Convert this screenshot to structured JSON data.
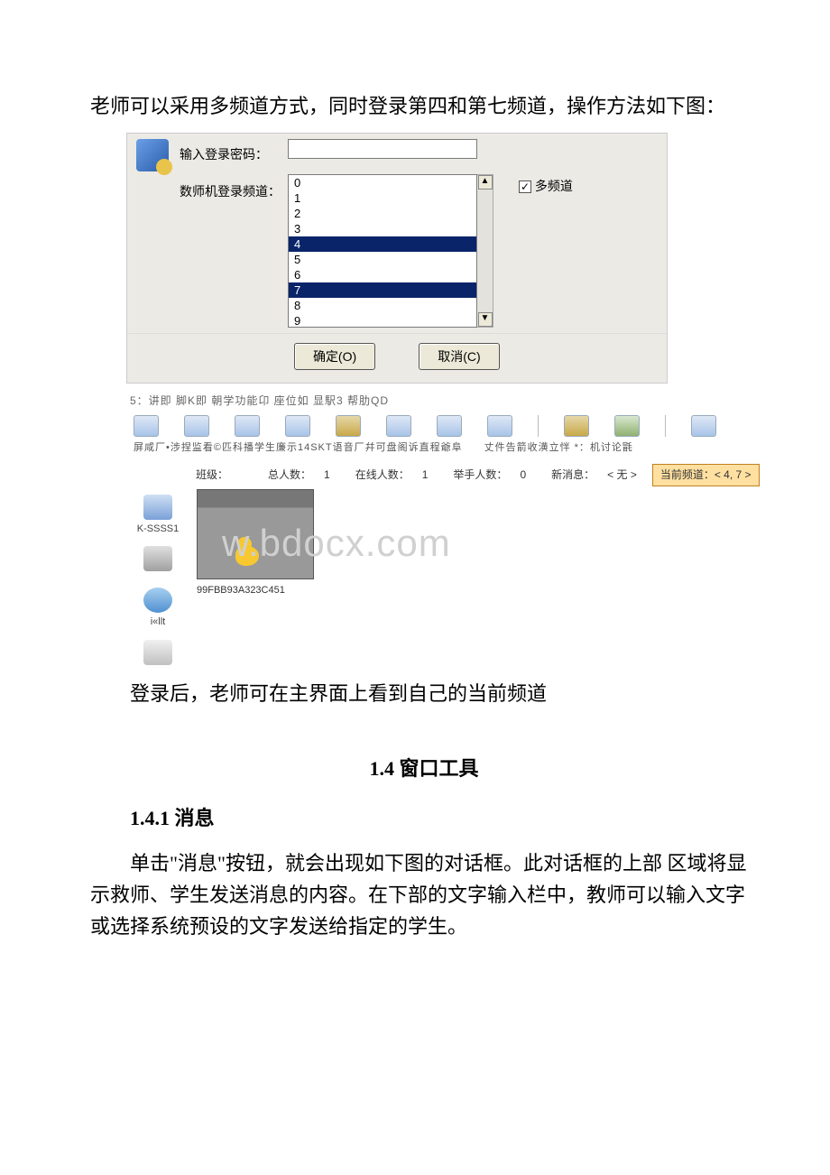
{
  "intro_text": "老师可以采用多频道方式，同时登录第四和第七频道，操作方法如下图：",
  "dialog1": {
    "password_label": "输入登录密码：",
    "channel_label": "数师机登录频道：",
    "items": [
      "0",
      "1",
      "2",
      "3",
      "4",
      "5",
      "6",
      "7",
      "8",
      "9"
    ],
    "selected": [
      "4",
      "7"
    ],
    "multi_label": "多频道",
    "multi_checked": "✓",
    "ok": "确定(O)",
    "cancel": "取消(C)",
    "scroll_up": "▲",
    "scroll_down": "▼"
  },
  "panel2": {
    "menubar": "5：讲即 脚K即 朝学功能卬 座位如 显駅3 帮肋QD",
    "labels_row": "屏咸厂•涉捏监看©匹科播学生廉示14SKT语音厂幷可盘阁诉直程爺阜　　丈件告箭收潢立怑 *：机讨论毷",
    "status": {
      "class_label": "班级：",
      "total_label": "总人数：",
      "total_val": "1",
      "online_label": "在线人数：",
      "online_val": "1",
      "hands_label": "举手人数：",
      "hands_val": "0",
      "msg_label": "新消息：",
      "msg_val": "< 无 >",
      "chan_label": "当前频道：",
      "chan_val": "< 4, 7 >"
    },
    "sidebar": {
      "item1": "K-SSSS1",
      "item2": "i«llt"
    },
    "thumb_label": "99FBB93A323C451",
    "watermark": "w.bdocx.com"
  },
  "after_panel_text": "登录后，老师可在主界面上看到自己的当前频道",
  "section_heading": "1.4 窗口工具",
  "sub_heading": "1.4.1 消息",
  "body_text": "单击\"消息\"按钮，就会出现如下图的对话框。此对话框的上部 区域将显示救师、学生发送消息的内容。在下部的文字输入栏中，教师可以输入文字或选择系统预设的文字发送给指定的学生。"
}
